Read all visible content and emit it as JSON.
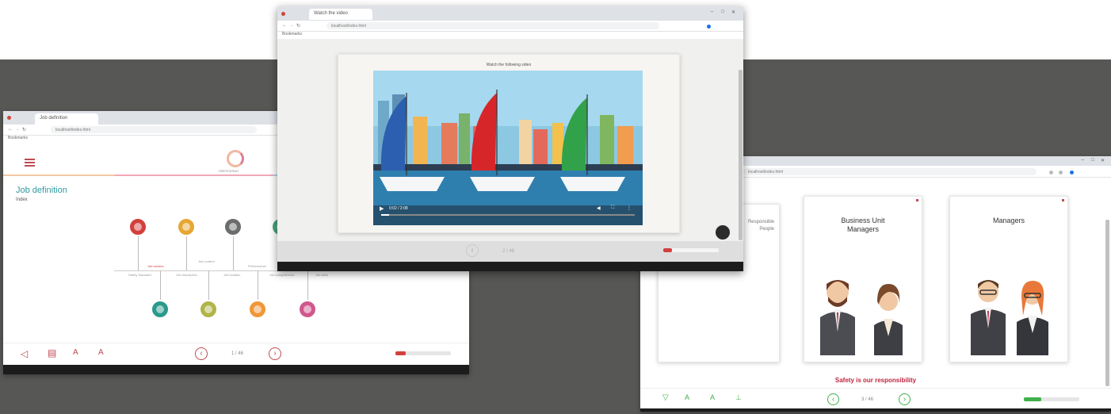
{
  "left_window": {
    "browser_tab": "Job definition",
    "url": "localhost/index.html",
    "bookmarks": "Bookmarks",
    "header_badge": "PARTICIPANT",
    "title": "Job definition",
    "subtitle": "Index",
    "timeline_labels": [
      "Safety Standard",
      "Job owners",
      "Job description",
      "Job content",
      "Job location",
      "Performance",
      "Job competences",
      "Job skills"
    ],
    "page_indicator": "1 / 46",
    "progress_fraction": 0.18,
    "colors": {
      "red": "#d2403d",
      "yellow": "#e7a634",
      "gray": "#6b6d6c",
      "green": "#49a57c",
      "teal": "#2a9a8a",
      "olive": "#b1b448",
      "orange": "#f0973a",
      "pink": "#d0588c",
      "accent": "#c04a50"
    }
  },
  "center_window": {
    "browser_tab": "Watch the video",
    "url": "localhost/index.html",
    "bookmarks": "Bookmarks",
    "heading": "Watch the following video",
    "video_time": "0:02 / 2:08",
    "page_indicator": "2 / 46",
    "progress_fraction": 0.15,
    "sail_colors": [
      "#2c5fb0",
      "#d7262a",
      "#31a24a"
    ]
  },
  "right_window": {
    "url": "localhost/index.html",
    "card_partial": "Responsible People",
    "card_business": "Business Unit Managers",
    "card_managers": "Managers",
    "footer_text": "Safety is our responsibility",
    "page_indicator": "3 / 46",
    "progress_fraction": 0.32,
    "colors": {
      "green": "#40b04a",
      "crimson": "#c0243e"
    }
  },
  "icons": {
    "menu": "hamburger-menu-icon",
    "volume": "volume-icon",
    "glossary": "book-icon",
    "font_increase": "text-increase-icon",
    "font_decrease": "text-decrease-icon",
    "prev": "chevron-left-icon",
    "next": "chevron-right-icon",
    "expand": "expand-icon"
  }
}
